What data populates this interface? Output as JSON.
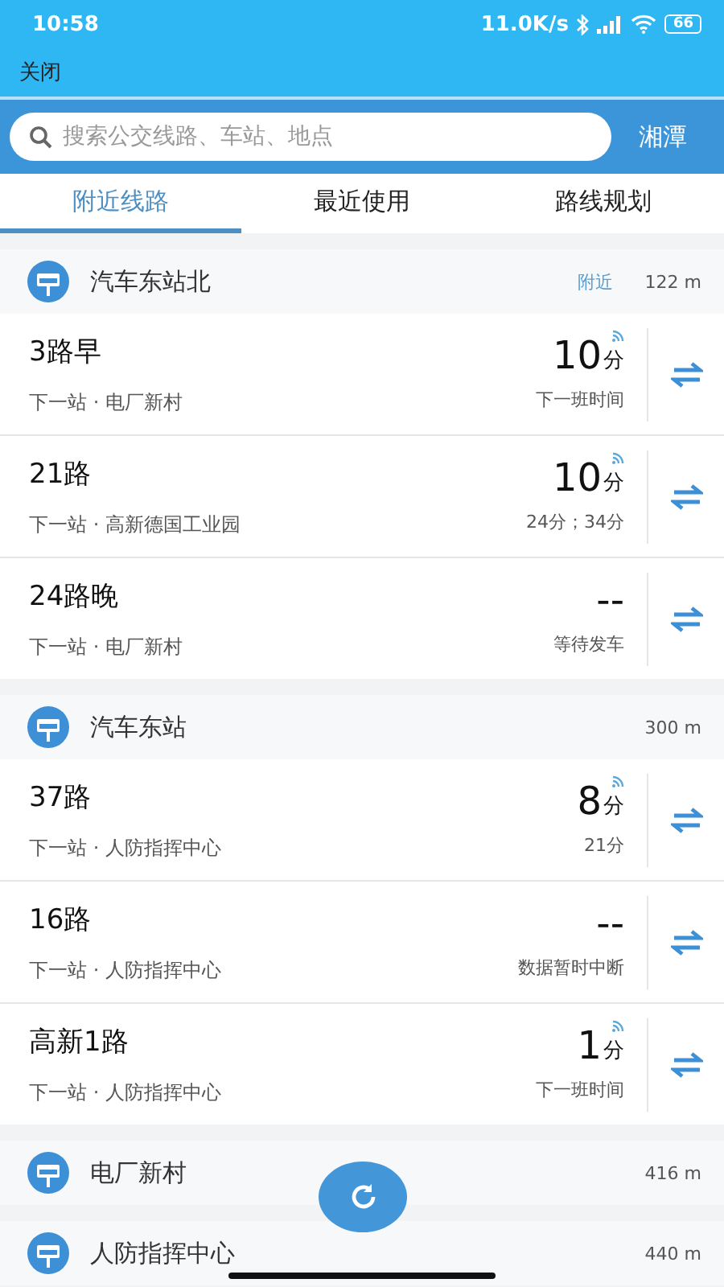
{
  "status_bar": {
    "time": "10:58",
    "net_speed": "11.0K/s",
    "battery": "66"
  },
  "top_bar": {
    "close": "关闭"
  },
  "search": {
    "placeholder": "搜索公交线路、车站、地点",
    "city": "湘潭"
  },
  "tabs": [
    {
      "label": "附近线路",
      "selected": true
    },
    {
      "label": "最近使用",
      "selected": false
    },
    {
      "label": "路线规划",
      "selected": false
    }
  ],
  "stations": [
    {
      "name": "汽车东站北",
      "tag": "附近",
      "distance": "122 m",
      "routes": [
        {
          "name": "3路早",
          "next_stop": "下一站 · 电厂新村",
          "time": "10",
          "unit": "分",
          "realtime": true,
          "note": "下一班时间"
        },
        {
          "name": "21路",
          "next_stop": "下一站 · 高新德国工业园",
          "time": "10",
          "unit": "分",
          "realtime": true,
          "note": "24分；34分"
        },
        {
          "name": "24路晚",
          "next_stop": "下一站 · 电厂新村",
          "time": "--",
          "realtime": false,
          "note": "等待发车"
        }
      ]
    },
    {
      "name": "汽车东站",
      "distance": "300 m",
      "routes": [
        {
          "name": "37路",
          "next_stop": "下一站 · 人防指挥中心",
          "time": "8",
          "unit": "分",
          "realtime": true,
          "note": "21分"
        },
        {
          "name": "16路",
          "next_stop": "下一站 · 人防指挥中心",
          "time": "--",
          "realtime": false,
          "note": "数据暂时中断"
        },
        {
          "name": "高新1路",
          "next_stop": "下一站 · 人防指挥中心",
          "time": "1",
          "unit": "分",
          "realtime": true,
          "note": "下一班时间"
        }
      ]
    },
    {
      "name": "电厂新村",
      "distance": "416 m"
    },
    {
      "name": "人防指挥中心",
      "distance": "440 m"
    }
  ]
}
